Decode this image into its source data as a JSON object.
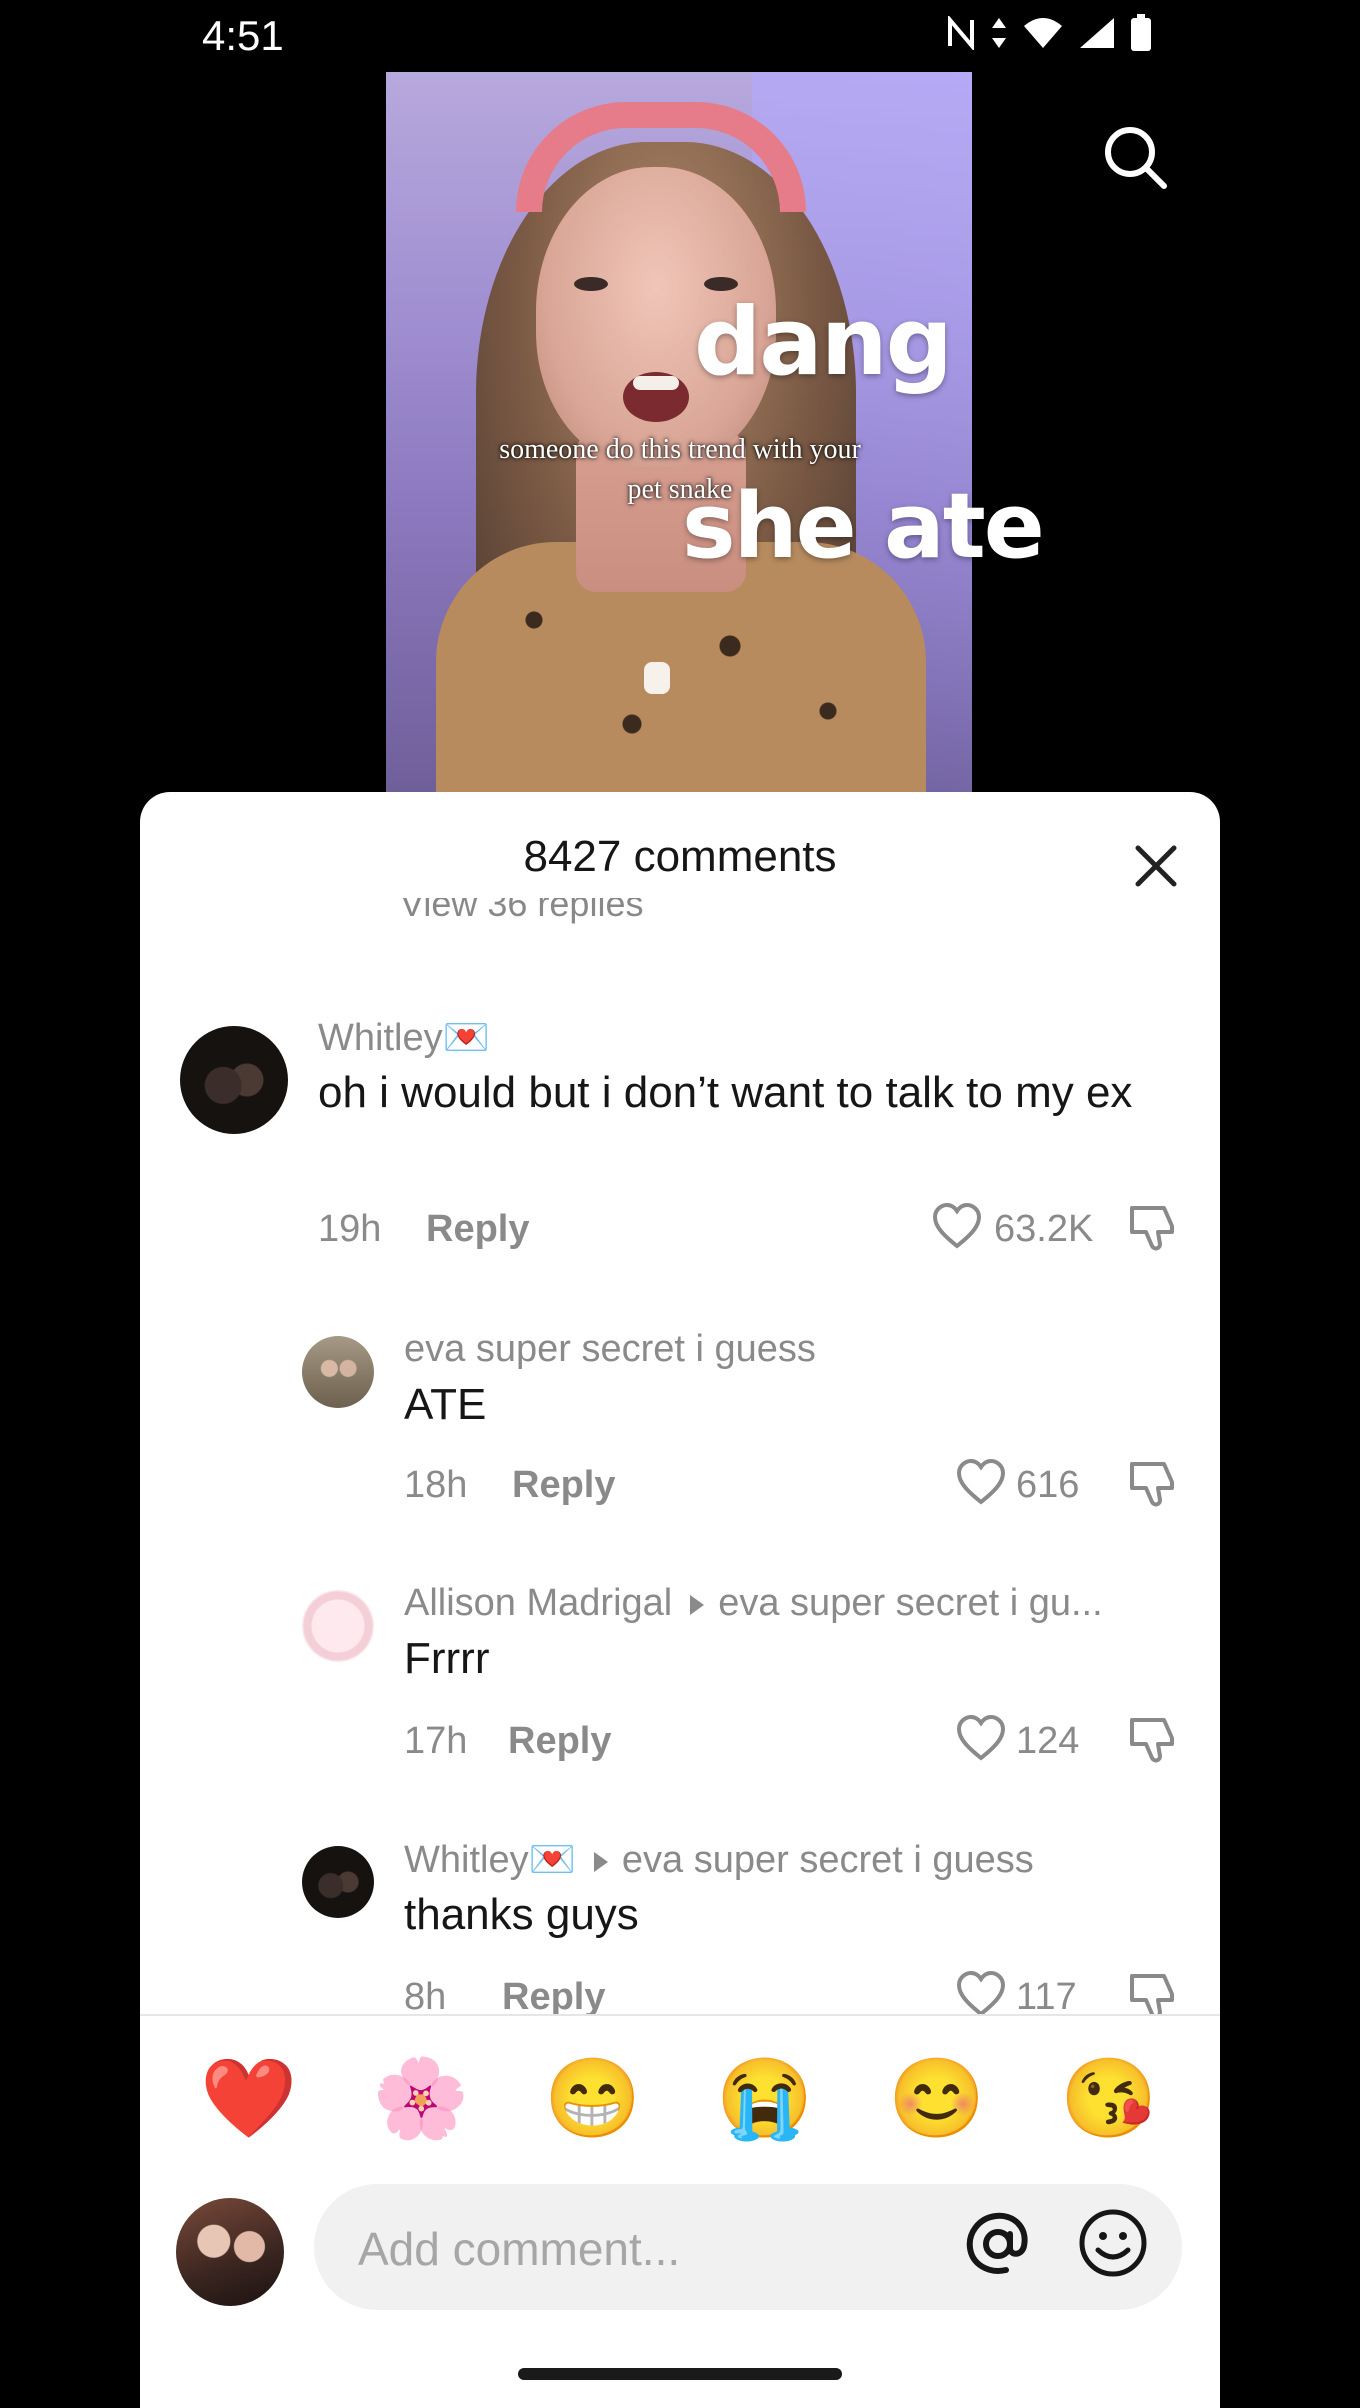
{
  "status": {
    "time": "4:51"
  },
  "video": {
    "caption": "someone do this trend with your pet snake",
    "overlay_1": "dang",
    "overlay_2": "she ate"
  },
  "sheet": {
    "title": "8427 comments",
    "view_replies_partial": "View 36 replies",
    "input_placeholder": "Add comment...",
    "reactions": [
      "❤️",
      "🌸",
      "😁",
      "😭",
      "😊",
      "😘"
    ]
  },
  "comments": [
    {
      "user": "Whitley💌",
      "text": "oh i would but i don’t want to talk to my ex",
      "time": "19h",
      "reply": "Reply",
      "likes": "63.2K"
    },
    {
      "user": "eva super secret i guess",
      "text": "ATE",
      "time": "18h",
      "reply": "Reply",
      "likes": "616"
    },
    {
      "user": "Allison Madrigal",
      "reply_to": "eva super secret i gu...",
      "text": "Frrrr",
      "time": "17h",
      "reply": "Reply",
      "likes": "124"
    },
    {
      "user": "Whitley💌",
      "reply_to": "eva super secret i guess",
      "text": "thanks guys",
      "time": "8h",
      "reply": "Reply",
      "likes": "117"
    }
  ]
}
